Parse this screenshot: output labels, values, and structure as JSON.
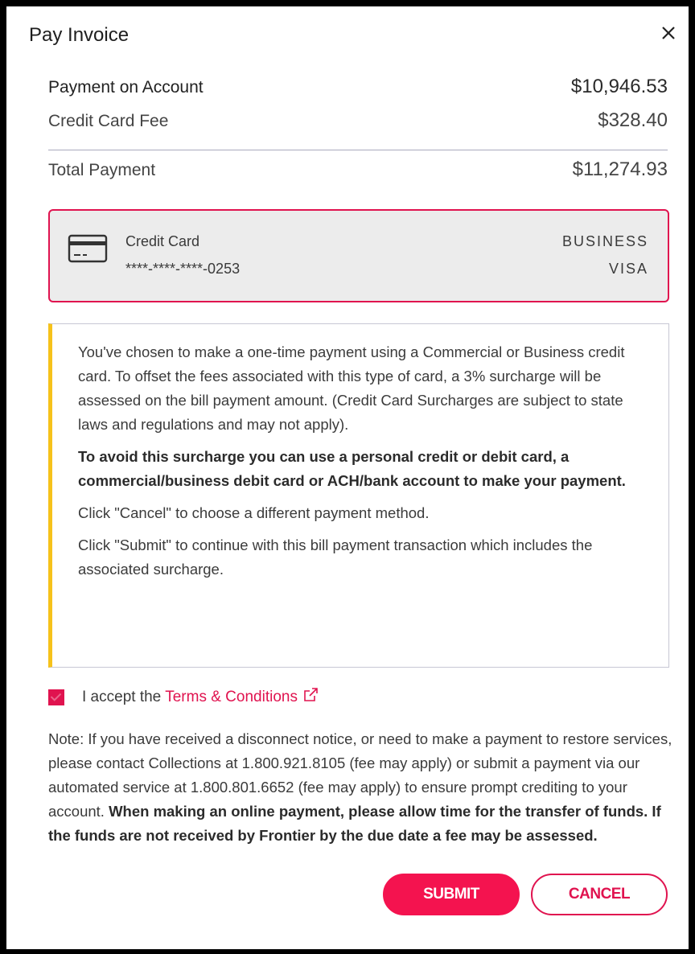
{
  "modal": {
    "title": "Pay Invoice",
    "close_icon": "close-icon"
  },
  "summary": {
    "payment_label": "Payment on Account",
    "payment_value": "$10,946.53",
    "fee_label": "Credit Card Fee",
    "fee_value": "$328.40",
    "total_label": "Total Payment",
    "total_value": "$11,274.93"
  },
  "card": {
    "icon": "credit-card-icon",
    "type": "Credit Card",
    "number": "****-****-****-0253",
    "brand_line1": "BUSINESS",
    "brand_line2": "VISA"
  },
  "notice": {
    "paragraph1": "You've chosen to make a one-time payment using a Commercial or Business credit card. To offset the fees associated with this type of card, a 3% surcharge will be assessed on the bill payment amount. (Credit Card Surcharges are subject to state laws and regulations and may not apply).",
    "paragraph2": "To avoid this surcharge you can use a personal credit or debit card, a commercial/business debit card or ACH/bank account to make your payment.",
    "paragraph3": "Click \"Cancel\" to choose a different payment method.",
    "paragraph4": "Click \"Submit\" to continue with this bill payment transaction which includes the associated surcharge."
  },
  "terms": {
    "checked": true,
    "prefix": "I accept the",
    "link_text": "Terms & Conditions",
    "link_icon": "external-link-icon"
  },
  "note": {
    "text": "Note: If you have received a disconnect notice, or need to make a payment to restore services, please contact Collections at 1.800.921.8105 (fee may apply) or submit a payment via our automated service at 1.800.801.6652 (fee may apply) to ensure prompt crediting to your account.",
    "bold_text": "When making an online payment, please allow time for the transfer of funds. If the funds are not received by Frontier by the due date a fee may be assessed."
  },
  "buttons": {
    "submit": "SUBMIT",
    "cancel": "CANCEL"
  },
  "colors": {
    "accent": "#e0134f",
    "warning_bar": "#f6c21b",
    "card_bg": "#ececec"
  }
}
